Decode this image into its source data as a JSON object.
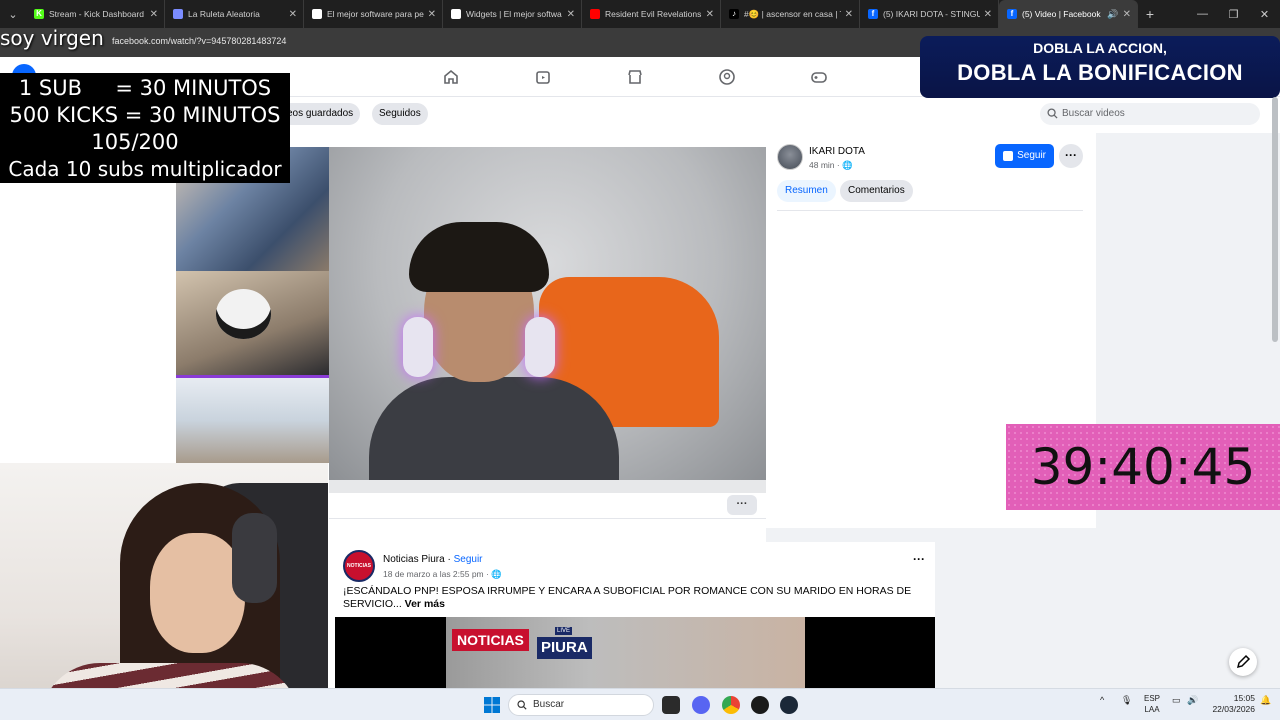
{
  "browser": {
    "tabs": [
      {
        "label": "Stream - Kick Dashboard",
        "favicon_color": "#53fc18",
        "favicon_char": "K"
      },
      {
        "label": "La Ruleta Aleatoria",
        "favicon_color": "#7b8cff",
        "favicon_char": ""
      },
      {
        "label": "El mejor software para pe",
        "favicon_color": "#ffffff",
        "favicon_char": ""
      },
      {
        "label": "Widgets | El mejor softwa",
        "favicon_color": "#ffffff",
        "favicon_char": ""
      },
      {
        "label": "Resident Evil Revelations",
        "favicon_color": "#ff0000",
        "favicon_char": ""
      },
      {
        "label": "#😊 | ascensor en casa | T",
        "favicon_color": "#000000",
        "favicon_char": "♪"
      },
      {
        "label": "(5) IKARI DOTA - STINGU",
        "favicon_color": "#0866ff",
        "favicon_char": "f"
      },
      {
        "label": "(5) Video | Facebook",
        "favicon_color": "#0866ff",
        "favicon_char": "f",
        "active": true
      }
    ],
    "url": "facebook.com/watch/?v=945780281483724"
  },
  "overlay": {
    "soy_virgen": "soy virgen",
    "sub_line1": "1 SUB     = 30 MINUTOS",
    "sub_line2": "500 KICKS = 30 MINUTOS",
    "sub_line3": "105/200",
    "sub_line4": "Cada 10 subs multiplicador",
    "promo_line1": "DOBLA LA ACCION,",
    "promo_line2": "DOBLA LA BONIFICACION",
    "timer": "39:40:45"
  },
  "watch": {
    "saved_videos": "eos guardados",
    "following": "Seguidos",
    "search_placeholder": "Buscar videos"
  },
  "video_post": {
    "author": "IKARI DOTA",
    "time": "48 min · 🌐",
    "follow": "Seguir",
    "more": "···",
    "tab_summary": "Resumen",
    "tab_comments": "Comentarios"
  },
  "news_post": {
    "author": "Noticias Piura",
    "dot": " · ",
    "follow": "Seguir",
    "date": "18 de marzo a las 2:55 pm · 🌐",
    "text": "¡ESCÁNDALO PNP! ESPOSA IRRUMPE Y ENCARA A SUBOFICIAL POR  ROMANCE CON SU MARIDO EN HORAS DE SERVICIO... ",
    "see_more": "Ver más",
    "badge_noticias": "NOTICIAS",
    "badge_live": "LIVE",
    "badge_piura": "PIURA",
    "avatar_text": "NOTICIAS PIURA",
    "more": "···"
  },
  "taskbar": {
    "search": "Buscar",
    "lang_line1": "ESP",
    "lang_line2": "LAA",
    "time": "15:05",
    "date": "22/03/2026"
  }
}
